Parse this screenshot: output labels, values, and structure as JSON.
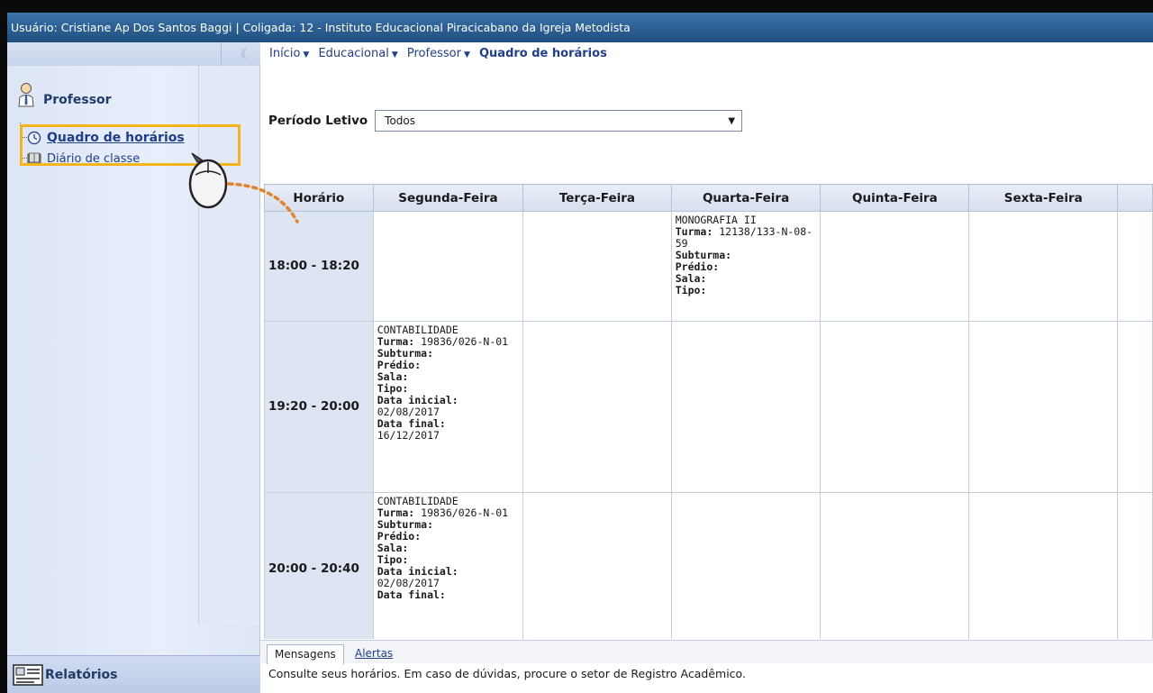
{
  "topbar": {
    "text": "Usuário: Cristiane Ap Dos Santos Baggi  |  Coligada: 12 - Instituto Educacional Piracicabano da Igreja Metodista"
  },
  "sidebar": {
    "collapse_glyph": "《",
    "group_title": "Professor",
    "items": [
      {
        "label": "Quadro de horários",
        "icon": "clock-icon",
        "selected": true
      },
      {
        "label": "Diário de classe",
        "icon": "book-icon",
        "selected": false
      }
    ],
    "reports_label": "Relatórios"
  },
  "breadcrumb": {
    "items": [
      "Início",
      "Educacional",
      "Professor"
    ],
    "current": "Quadro de horários"
  },
  "period": {
    "label": "Período Letivo",
    "value": "Todos"
  },
  "schedule": {
    "headers": [
      "Horário",
      "Segunda-Feira",
      "Terça-Feira",
      "Quarta-Feira",
      "Quinta-Feira",
      "Sexta-Feira"
    ],
    "rows": [
      {
        "time": "18:00 - 18:20",
        "cells": [
          null,
          null,
          {
            "course": "MONOGRAFIA II",
            "fields": [
              {
                "label": "Turma:",
                "value": "12138/133-N-08-59"
              },
              {
                "label": "Subturma:",
                "value": ""
              },
              {
                "label": "Prédio:",
                "value": ""
              },
              {
                "label": "Sala:",
                "value": ""
              },
              {
                "label": "Tipo:",
                "value": ""
              }
            ]
          },
          null,
          null
        ]
      },
      {
        "time": "19:20 - 20:00",
        "cells": [
          {
            "course": "CONTABILIDADE",
            "fields": [
              {
                "label": "Turma:",
                "value": "19836/026-N-01"
              },
              {
                "label": "Subturma:",
                "value": ""
              },
              {
                "label": "Prédio:",
                "value": ""
              },
              {
                "label": "Sala:",
                "value": ""
              },
              {
                "label": "Tipo:",
                "value": ""
              },
              {
                "label": "Data inicial:",
                "value": "02/08/2017"
              },
              {
                "label": "Data final:",
                "value": "16/12/2017"
              }
            ]
          },
          null,
          null,
          null,
          null
        ]
      },
      {
        "time": "20:00 - 20:40",
        "cells": [
          {
            "course": "CONTABILIDADE",
            "fields": [
              {
                "label": "Turma:",
                "value": "19836/026-N-01"
              },
              {
                "label": "Subturma:",
                "value": ""
              },
              {
                "label": "Prédio:",
                "value": ""
              },
              {
                "label": "Sala:",
                "value": ""
              },
              {
                "label": "Tipo:",
                "value": ""
              },
              {
                "label": "Data inicial:",
                "value": "02/08/2017"
              },
              {
                "label": "Data final:",
                "value": ""
              }
            ]
          },
          null,
          null,
          null,
          null
        ]
      }
    ]
  },
  "bottom_tabs": {
    "active": "Mensagens",
    "other": "Alertas"
  },
  "message": "Consulte seus horários. Em caso de dúvidas, procure o setor de Registro Acadêmico.",
  "colors": {
    "topbar": "#2a5e92",
    "highlight": "#f5b51a",
    "link": "#1e3f8f",
    "annotation_dash": "#e0832a"
  }
}
